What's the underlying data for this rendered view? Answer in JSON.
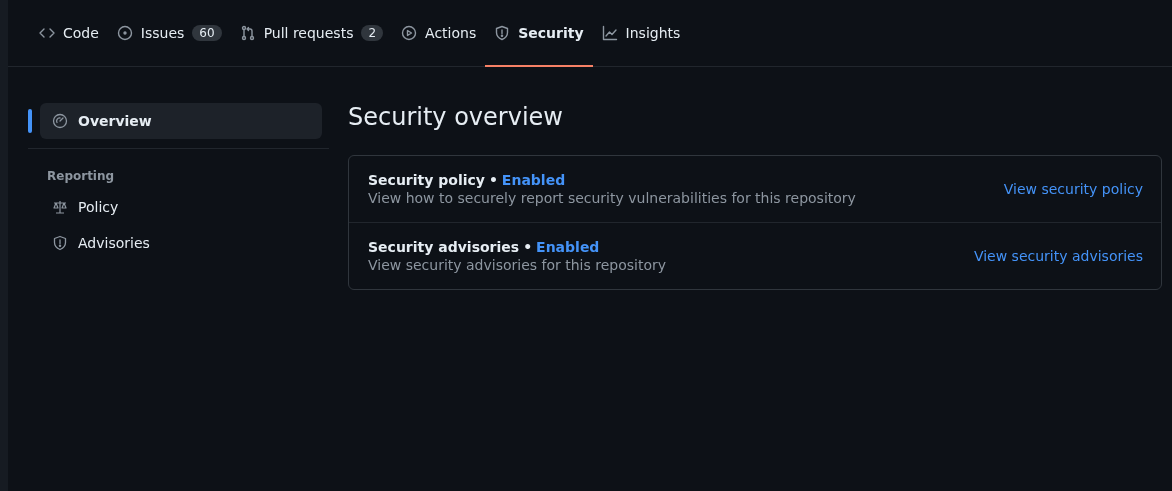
{
  "tabs": [
    {
      "label": "Code",
      "selected": false
    },
    {
      "label": "Issues",
      "count": "60",
      "selected": false
    },
    {
      "label": "Pull requests",
      "count": "2",
      "selected": false
    },
    {
      "label": "Actions",
      "selected": false
    },
    {
      "label": "Security",
      "selected": true
    },
    {
      "label": "Insights",
      "selected": false
    }
  ],
  "sidebar": {
    "items": [
      {
        "label": "Overview",
        "selected": true
      }
    ],
    "section_heading": "Reporting",
    "section_items": [
      {
        "label": "Policy",
        "selected": false
      },
      {
        "label": "Advisories",
        "selected": false
      }
    ]
  },
  "page_title": "Security overview",
  "features": [
    {
      "title": "Security policy",
      "separator": "•",
      "status": "Enabled",
      "description": "View how to securely report security vulnerabilities for this repository",
      "link": "View security policy"
    },
    {
      "title": "Security advisories",
      "separator": "•",
      "status": "Enabled",
      "description": "View security advisories for this repository",
      "link": "View security advisories"
    }
  ]
}
